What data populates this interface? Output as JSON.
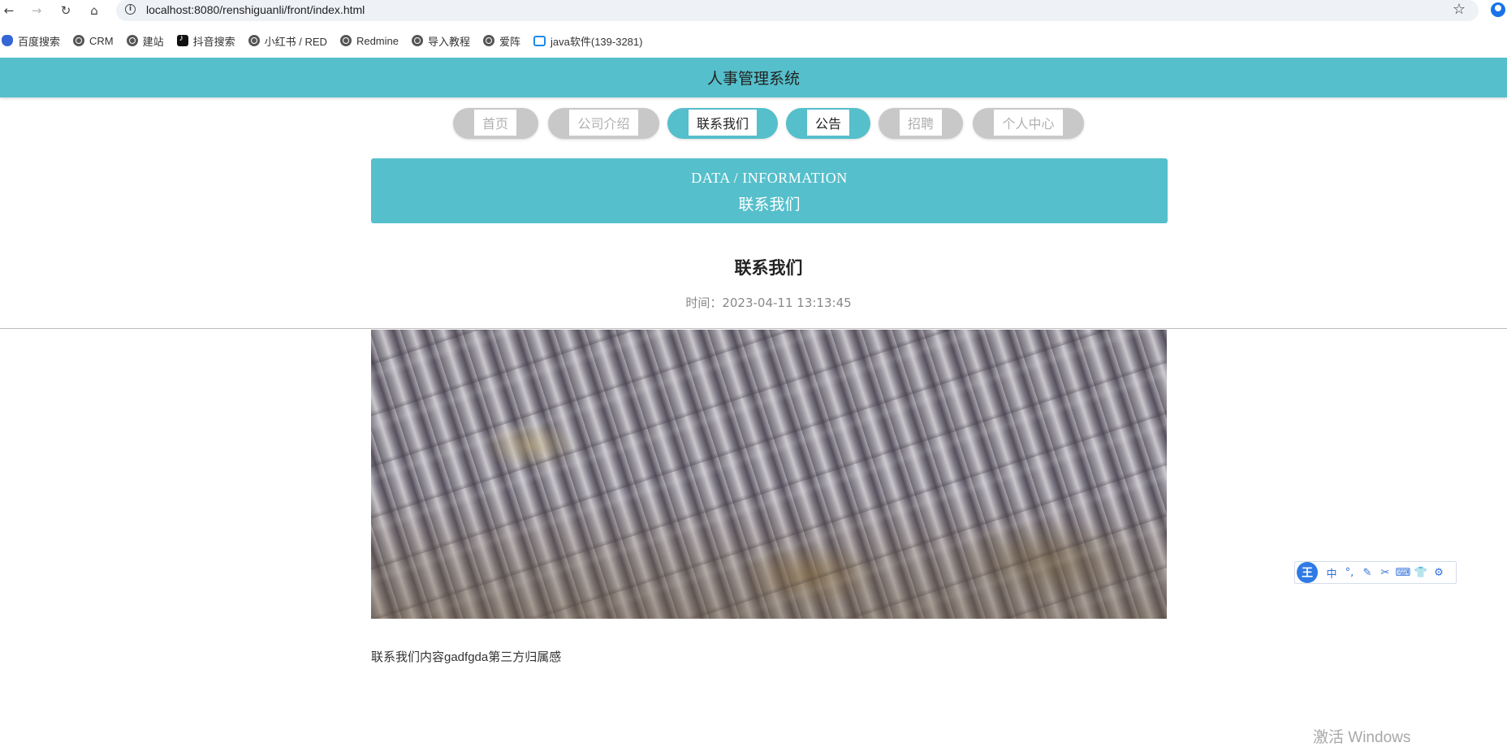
{
  "browser": {
    "url": "localhost:8080/renshiguanli/front/index.html",
    "bookmarks": [
      "百度搜索",
      "CRM",
      "建站",
      "抖音搜索",
      "小红书 / RED",
      "Redmine",
      "导入教程",
      "爱阵",
      "java软件(139-3281)"
    ]
  },
  "site": {
    "title": "人事管理系统",
    "nav": [
      "首页",
      "公司介绍",
      "联系我们",
      "公告",
      "招聘",
      "个人中心"
    ],
    "active_nav": "联系我们"
  },
  "banner": {
    "en": "DATA / INFORMATION",
    "cn": "联系我们"
  },
  "article": {
    "title": "联系我们",
    "time": "时间：2023-04-11 13:13:45",
    "body": "联系我们内容gadfgda第三方归属感"
  },
  "ime": {
    "logo": "王",
    "mode": "中"
  },
  "watermark": "激活 Windows",
  "colors": {
    "accent": "#55bfcb",
    "pill_inactive": "#c8c8c8"
  }
}
